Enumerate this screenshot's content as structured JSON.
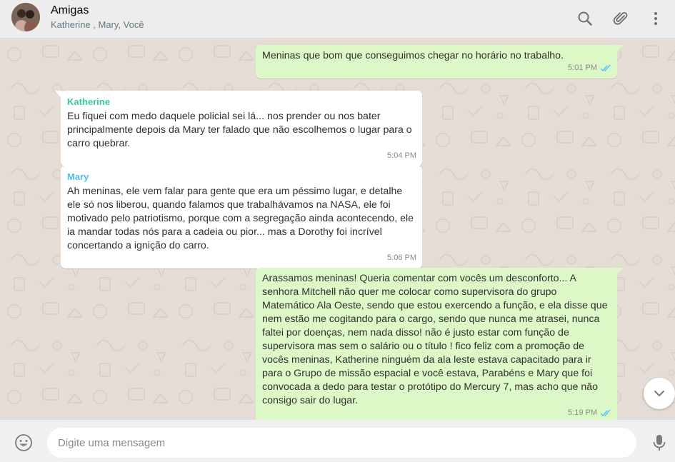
{
  "header": {
    "title": "Amigas",
    "members": "Katherine , Mary, Você",
    "icons": [
      "search-icon",
      "attach-icon",
      "menu-icon"
    ]
  },
  "colors": {
    "outgoing_bubble": "#dcf8c6",
    "incoming_bubble": "#ffffff",
    "katherine_name": "#35cd96",
    "mary_name": "#53bdeb",
    "read_ticks": "#4fc3f7",
    "background": "#e5ddd5"
  },
  "messages": [
    {
      "direction": "out",
      "text": "Meninas que bom que conseguimos chegar no horário no trabalho.",
      "time": "5:01 PM",
      "status": "read"
    },
    {
      "direction": "in",
      "sender": "Katherine",
      "text": "Eu fiquei com medo daquele policial sei lá... nos prender ou nos bater principalmente depois da Mary ter falado que não escolhemos o lugar para o carro quebrar.",
      "time": "5:04 PM"
    },
    {
      "direction": "in",
      "sender": "Mary",
      "text": "Ah meninas, ele vem falar para gente que era um péssimo lugar, e detalhe ele só nos liberou, quando falamos que trabalhávamos na NASA, ele foi motivado pelo patriotismo, porque com a segregação ainda acontecendo, ele ia mandar todas nós para a cadeia ou pior... mas a Dorothy foi incrível concertando a ignição do carro.",
      "time": "5:06 PM"
    },
    {
      "direction": "out",
      "text": "Arassamos meninas! Queria comentar com vocês um desconforto...  A senhora Mitchell não quer me colocar como supervisora do grupo Matemático Ala Oeste, sendo que estou exercendo a função, e ela disse que nem estão me cogitando para o cargo, sendo que nunca me atrasei, nunca faltei por doenças, nem nada disso! não é justo estar com função de supervisora mas sem o salário ou o título ! fico feliz com a promoção de vocês meninas, Katherine ninguém da ala leste estava capacitado para ir para o Grupo de missão espacial e você estava, Parabéns e Mary que foi convocada a dedo para testar o protótipo do Mercury 7, mas acho que não consigo sair do lugar.",
      "time": "5:19 PM",
      "status": "read"
    }
  ],
  "composer": {
    "placeholder": "Digite uma mensagem",
    "value": "",
    "icons": [
      "emoji-icon",
      "microphone-icon"
    ]
  }
}
